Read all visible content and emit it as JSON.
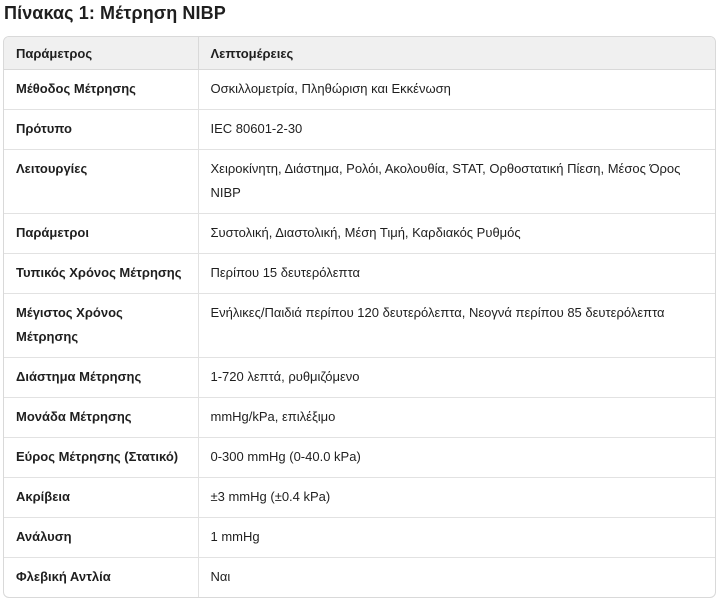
{
  "title": "Πίνακας 1: Μέτρηση NIBP",
  "table": {
    "headers": [
      "Παράμετρος",
      "Λεπτομέρειες"
    ],
    "rows": [
      {
        "param": "Μέθοδος Μέτρησης",
        "details": "Οσκιλλομετρία, Πληθώριση και Εκκένωση"
      },
      {
        "param": "Πρότυπο",
        "details": "IEC 80601-2-30"
      },
      {
        "param": "Λειτουργίες",
        "details": "Χειροκίνητη, Διάστημα, Ρολόι, Ακολουθία, STAT, Ορθοστατική Πίεση, Μέσος Όρος NIBP"
      },
      {
        "param": "Παράμετροι",
        "details": "Συστολική, Διαστολική, Μέση Τιμή, Καρδιακός Ρυθμός"
      },
      {
        "param": "Τυπικός Χρόνος Μέτρησης",
        "details": "Περίπου 15 δευτερόλεπτα"
      },
      {
        "param": "Μέγιστος Χρόνος Μέτρησης",
        "details": "Ενήλικες/Παιδιά περίπου 120 δευτερόλεπτα, Νεογνά περίπου 85 δευτερόλεπτα"
      },
      {
        "param": "Διάστημα Μέτρησης",
        "details": "1-720 λεπτά, ρυθμιζόμενο"
      },
      {
        "param": "Μονάδα Μέτρησης",
        "details": "mmHg/kPa, επιλέξιμο"
      },
      {
        "param": "Εύρος Μέτρησης (Στατικό)",
        "details": "0-300 mmHg (0-40.0 kPa)"
      },
      {
        "param": "Ακρίβεια",
        "details": "±3 mmHg (±0.4 kPa)"
      },
      {
        "param": "Ανάλυση",
        "details": "1 mmHg"
      },
      {
        "param": "Φλεβική Αντλία",
        "details": "Ναι"
      }
    ]
  }
}
